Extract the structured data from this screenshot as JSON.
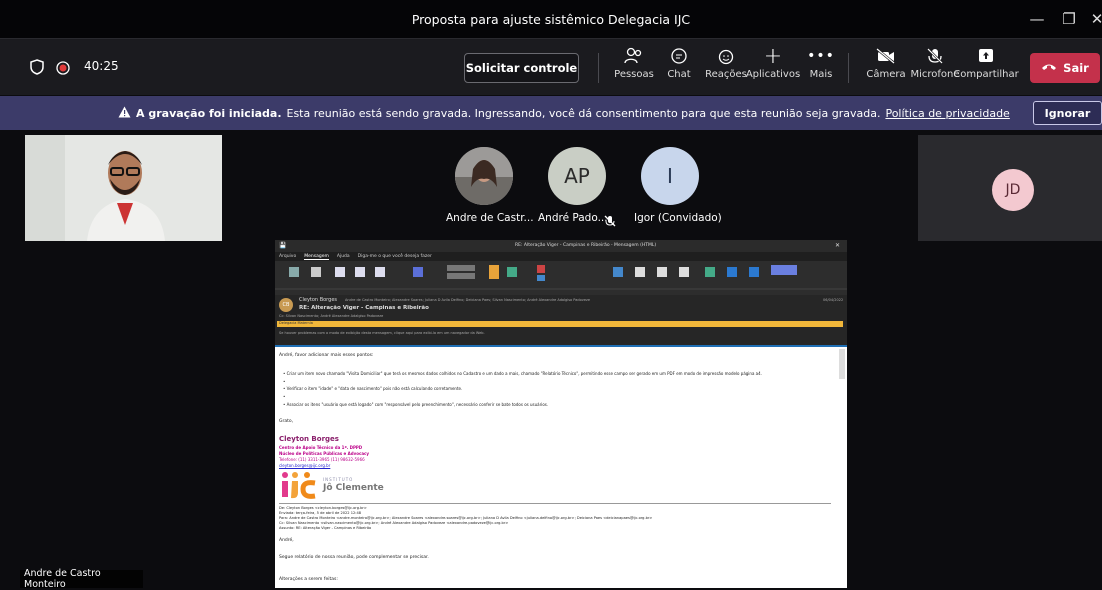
{
  "window": {
    "title": "Proposta para ajuste sistêmico Delegacia IJC"
  },
  "toolbar": {
    "timer": "40:25",
    "request_control": "Solicitar controle",
    "people": "Pessoas",
    "chat": "Chat",
    "reactions": "Reações",
    "apps": "Aplicativos",
    "more": "Mais",
    "camera": "Câmera",
    "microphone": "Microfone",
    "share": "Compartilhar",
    "leave": "Sair"
  },
  "banner": {
    "title": "A gravação foi iniciada.",
    "message": "Esta reunião está sendo gravada. Ingressando, você dá consentimento para que esta reunião seja gravada.",
    "link": "Política de privacidade",
    "dismiss": "Ignorar",
    "color": "#3c3b69"
  },
  "participants": [
    {
      "name": "Andre de Castr...",
      "initials": ""
    },
    {
      "name": "André Pado...",
      "initials": "AP"
    },
    {
      "name": "Igor (Convidado)",
      "initials": "I"
    }
  ],
  "tiles": {
    "jd_initials": "JD",
    "presenter_name": "Andre de Castro Monteiro"
  },
  "email": {
    "window_title": "RE: Alteração Viger - Campinas e Ribeirão  -  Mensagem (HTML)",
    "ribbon_tabs": [
      "Arquivo",
      "Mensagem",
      "Ajuda",
      "Diga-me o que você deseja fazer"
    ],
    "sender": "Cleyton Borges",
    "subject": "RE: Alteração Viger - Campinas e Ribeirão",
    "recipients": "Andre de Castro Monteiro; Alexandre Soares; Juliana D Avila Delfino; Deiciana Paes; Silvan Nascimento; André Alexandre Adalgiso Padoveze",
    "cc": "Cc: Silvan Nascimento; André Alexandre Adalgiso Padoveze",
    "date": "06/04/2022",
    "category": "Delegacia Maternia",
    "notice": "Se houver problemas com o modo de exibição desta mensagem, clique aqui para exibi-la em um navegador da Web.",
    "greeting": "André, favor adicionar mais esses pontos:",
    "bullets": [
      "Criar um item novo chamado \"Visita Domiciliar\" que terá os mesmos dados colhidos no Cadastro e um dado a mais, chamado \"Relatório Técnico\", permitindo esse campo ser gerado em um PDF em modo de impressão modelo página a4.",
      "Verificar o item \"idade\" e \"data de nascimento\" pois não está calculando corretamente.",
      "Associar os itens \"usuário que está logado\" com \"responsável pelo preenchimento\", necessário conferir se bate todos os usuários."
    ],
    "thanks": "Grato,",
    "sig_name": "Cleyton Borges",
    "sig_lines": [
      "Centro de Apoio Técnico da 1ª. DPPD",
      "Núcleo de Políticas Públicas e Advocacy",
      "Telefone: (11) 3311-3965  (11) 98632-5966",
      "cleyton.borges@ijc.org.br"
    ],
    "logo_top": "INSTITUTO",
    "logo_name": "Jô Clemente",
    "fwd_from": "De: Cleyton Borges <cleyton.borges@ijc.org.br>",
    "fwd_sent": "Enviada: terça-feira, 5 de abril de 2022 12:48",
    "fwd_to": "Para: Andre de Castro Monteiro <andre.monteiro@ijc.org.br>; Alexandre Soares <alexandre.soares@ijc.org.br>; Juliana D Avila Delfino <juliana.delfino@ijc.org.br>; Deiciana Paes <deicianapaes@ijc.org.br>",
    "fwd_cc": "Cc: Silvan Nascimento <silvan.nascimento@ijc.org.br>; André Alexandre Adalgiso Padoveze <alexandre.padoveze@ijc.org.br>",
    "fwd_subject": "Assunto: RE: Alteração Viger - Campinas e Ribeirão",
    "body2_greeting": "André,",
    "body2_text": "Segue relatório de nossa reunião, pode complementar se precisar.",
    "body2_list": "Alterações a serem feitas:"
  }
}
